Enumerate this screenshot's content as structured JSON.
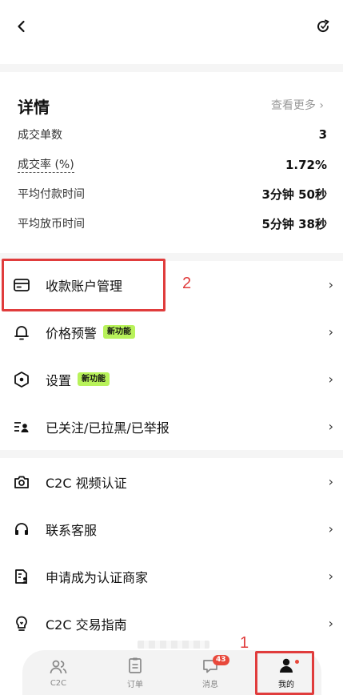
{
  "header": {
    "back_icon": "chevron-left-icon",
    "refresh_icon": "refresh-icon"
  },
  "details": {
    "title": "详情",
    "more_link": "查看更多 ›",
    "stats": [
      {
        "label": "成交单数",
        "value": "3"
      },
      {
        "label": "成交率 (%)",
        "value": "1.72%"
      },
      {
        "label": "平均付款时间",
        "value": "3分钟 50秒"
      },
      {
        "label": "平均放币时间",
        "value": "5分钟 38秒"
      }
    ]
  },
  "menu_group1": [
    {
      "label": "收款账户管理",
      "icon": "card-icon",
      "badge": ""
    },
    {
      "label": "价格预警",
      "icon": "bell-icon",
      "badge": "新功能"
    },
    {
      "label": "设置",
      "icon": "settings-hex-icon",
      "badge": "新功能"
    },
    {
      "label": "已关注/已拉黑/已举报",
      "icon": "user-list-icon",
      "badge": ""
    }
  ],
  "menu_group2": [
    {
      "label": "C2C 视频认证",
      "icon": "camera-icon"
    },
    {
      "label": "联系客服",
      "icon": "headset-icon"
    },
    {
      "label": "申请成为认证商家",
      "icon": "document-person-icon"
    },
    {
      "label": "C2C 交易指南",
      "icon": "lightbulb-icon"
    }
  ],
  "annotations": {
    "box1_number": "1",
    "box2_number": "2"
  },
  "tabbar": {
    "tabs": [
      {
        "label": "C2C",
        "icon": "users-icon"
      },
      {
        "label": "订单",
        "icon": "order-icon"
      },
      {
        "label": "消息",
        "icon": "chat-icon",
        "badge": "43"
      },
      {
        "label": "我的",
        "icon": "profile-icon"
      }
    ]
  },
  "colors": {
    "accent_new_badge": "#b8f25a",
    "annotation_red": "#e03c3c",
    "message_badge": "#e8483b"
  }
}
